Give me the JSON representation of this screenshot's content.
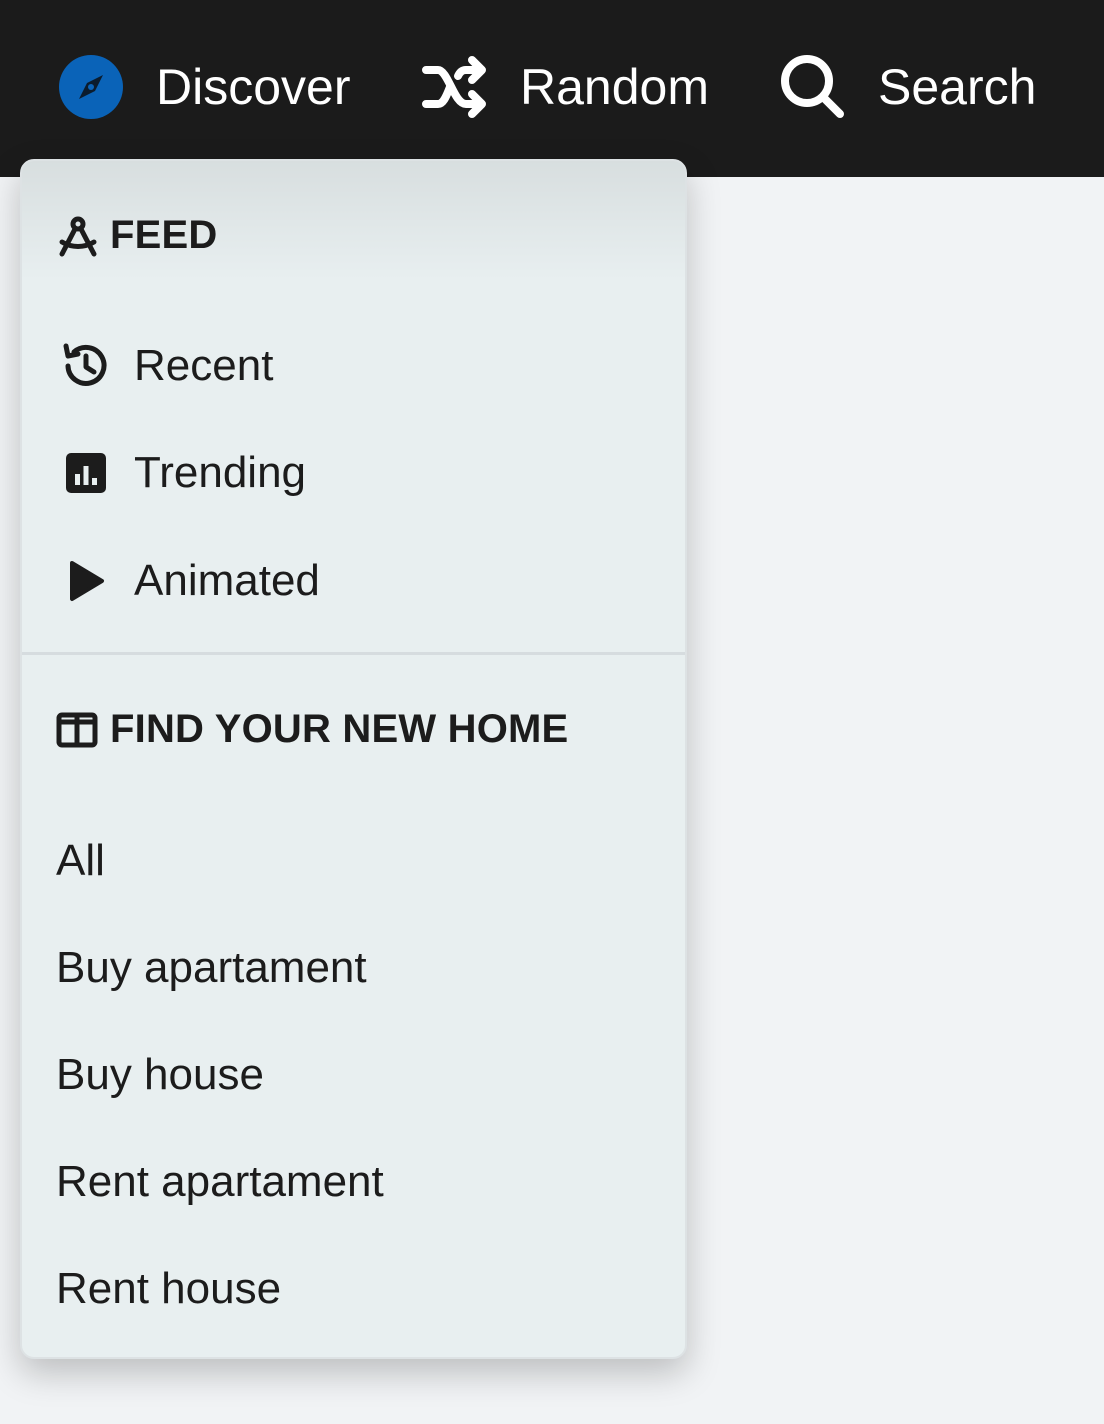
{
  "nav": {
    "discover_label": "Discover",
    "discover_icon": "compass-icon",
    "discover_icon_color": "#0a63b8",
    "random_label": "Random",
    "random_icon": "shuffle-icon",
    "search_label": "Search",
    "search_icon": "search-icon"
  },
  "dropdown": {
    "feed_section": {
      "title": "FEED",
      "icon": "compass-tool-icon",
      "items": [
        {
          "label": "Recent",
          "icon": "history-icon"
        },
        {
          "label": "Trending",
          "icon": "bar-chart-icon"
        },
        {
          "label": "Animated",
          "icon": "play-icon"
        }
      ]
    },
    "home_section": {
      "title": "FIND YOUR NEW HOME",
      "icon": "columns-icon",
      "items": [
        {
          "label": "All"
        },
        {
          "label": "Buy apartament"
        },
        {
          "label": "Buy house"
        },
        {
          "label": "Rent apartament"
        },
        {
          "label": "Rent house"
        }
      ]
    }
  },
  "colors": {
    "topbar_bg": "#1b1b1b",
    "dropdown_bg": "#e8eff0",
    "page_bg": "#f1f3f5"
  }
}
